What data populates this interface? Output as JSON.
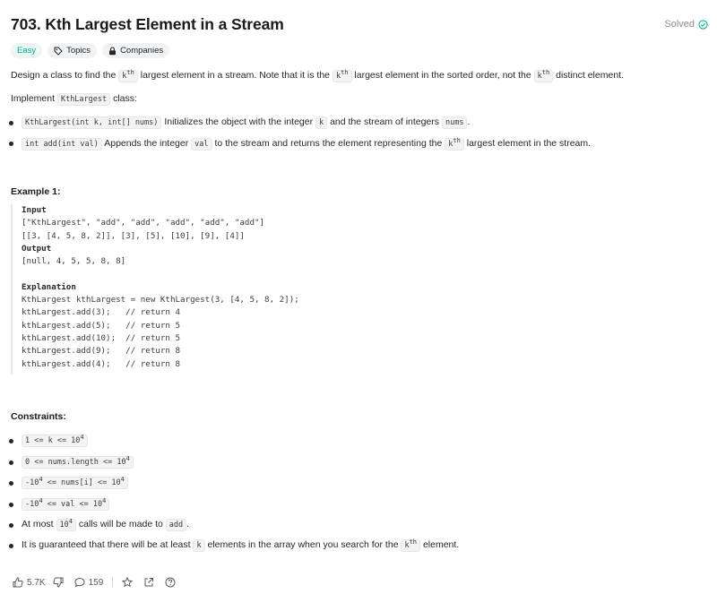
{
  "problem": {
    "title": "703. Kth Largest Element in a Stream",
    "status": "Solved"
  },
  "tags": {
    "difficulty": "Easy",
    "topics": "Topics",
    "companies": "Companies"
  },
  "description": {
    "p1_a": "Design a class to find the",
    "p1_k1": "k",
    "p1_th1": "th",
    "p1_b": "largest element in a stream. Note that it is the",
    "p1_k2": "k",
    "p1_th2": "th",
    "p1_c": "largest element in the sorted order, not the",
    "p1_k3": "k",
    "p1_th3": "th",
    "p1_d": "distinct element.",
    "p2_a": "Implement",
    "p2_code": "KthLargest",
    "p2_b": "class:",
    "b1_code": "KthLargest(int k, int[] nums)",
    "b1_a": "Initializes the object with the integer",
    "b1_k": "k",
    "b1_b": "and the stream of integers",
    "b1_nums": "nums",
    "b1_c": ".",
    "b2_code": "int add(int val)",
    "b2_a": "Appends the integer",
    "b2_val": "val",
    "b2_b": "to the stream and returns the element representing the",
    "b2_k": "k",
    "b2_th": "th",
    "b2_c": "largest element in the stream."
  },
  "example": {
    "heading": "Example 1:",
    "input_label": "Input",
    "input_line1": "[\"KthLargest\", \"add\", \"add\", \"add\", \"add\", \"add\"]",
    "input_line2": "[[3, [4, 5, 8, 2]], [3], [5], [10], [9], [4]]",
    "output_label": "Output",
    "output_line": "[null, 4, 5, 5, 8, 8]",
    "explanation_label": "Explanation",
    "exp_lines": [
      "KthLargest kthLargest = new KthLargest(3, [4, 5, 8, 2]);",
      "kthLargest.add(3);   // return 4",
      "kthLargest.add(5);   // return 5",
      "kthLargest.add(10);  // return 5",
      "kthLargest.add(9);   // return 8",
      "kthLargest.add(4);   // return 8"
    ]
  },
  "constraints": {
    "heading": "Constraints:",
    "c1_a": "1 <= k <= 10",
    "c1_sup": "4",
    "c2_a": "0 <= nums.length <= 10",
    "c2_sup": "4",
    "c3_a": "-10",
    "c3_sup1": "4",
    "c3_b": " <= nums[i] <= 10",
    "c3_sup2": "4",
    "c4_a": "-10",
    "c4_sup1": "4",
    "c4_b": " <= val <= 10",
    "c4_sup2": "4",
    "c5_a": "At most",
    "c5_code": "10",
    "c5_sup": "4",
    "c5_b": "calls will be made to",
    "c5_add": "add",
    "c5_c": ".",
    "c6_a": "It is guaranteed that there will be at least",
    "c6_k": "k",
    "c6_b": "elements in the array when you search for the",
    "c6_k2": "k",
    "c6_th": "th",
    "c6_c": "element."
  },
  "footer": {
    "likes": "5.7K",
    "comments": "159"
  },
  "colors": {
    "easy": "#00af9b",
    "text": "#262626",
    "muted": "#8c8c8c"
  }
}
